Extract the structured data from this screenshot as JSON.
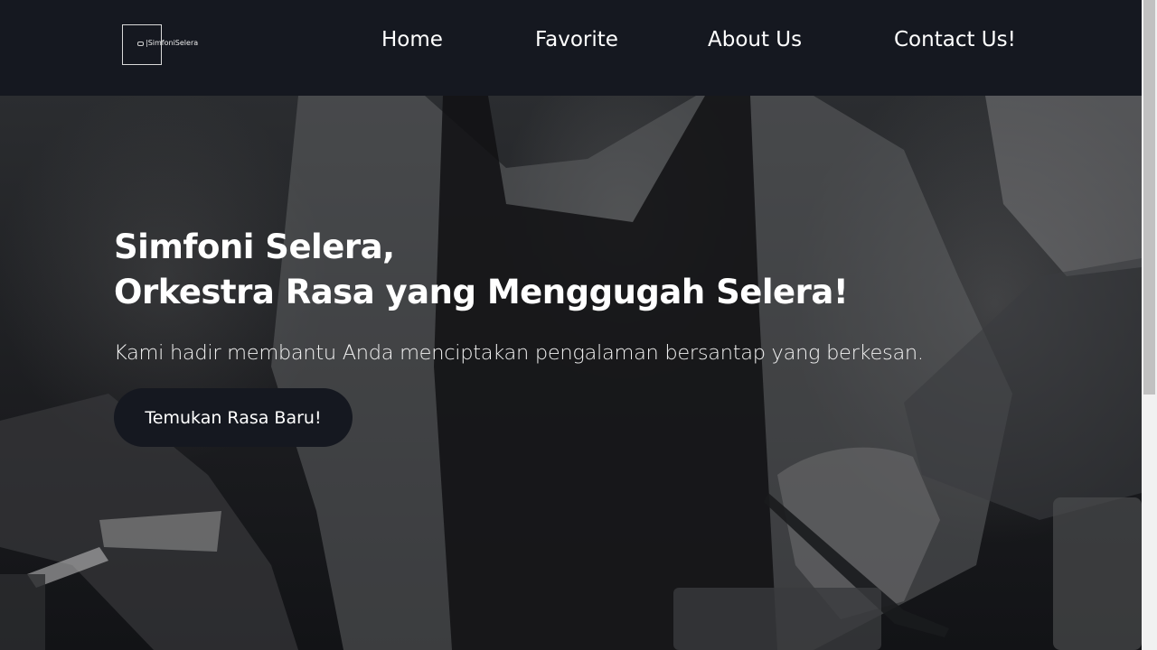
{
  "nav": {
    "logo_text": "|SimfoniSelera",
    "links": [
      "Home",
      "Favorite",
      "About Us",
      "Contact Us!"
    ]
  },
  "hero": {
    "title_line1": "Simfoni Selera,",
    "title_line2": "Orkestra Rasa yang Menggugah Selera!",
    "subtitle": "Kami hadir membantu Anda menciptakan pengalaman bersantap yang berkesan.",
    "cta_label": "Temukan Rasa Baru!"
  },
  "colors": {
    "nav_bg": "#151820",
    "button_bg": "#151820",
    "text": "#ffffff"
  }
}
